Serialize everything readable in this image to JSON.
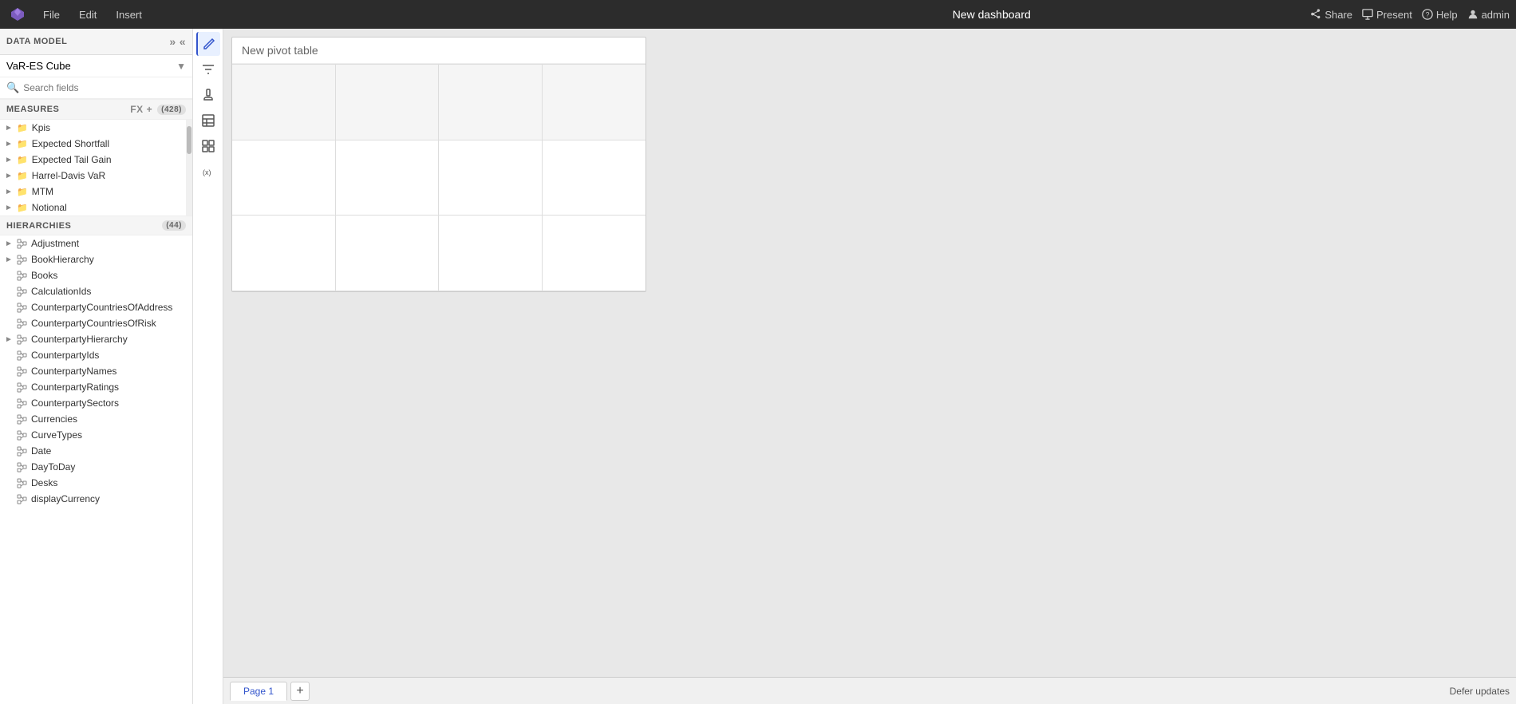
{
  "app": {
    "title": "New dashboard"
  },
  "menubar": {
    "file": "File",
    "edit": "Edit",
    "insert": "Insert",
    "share": "Share",
    "present": "Present",
    "help": "Help",
    "user": "admin"
  },
  "sidebar": {
    "data_model_label": "DATA MODEL",
    "data_model_selected": "VaR-ES Cube",
    "search_placeholder": "Search fields",
    "measures_label": "MEASURES",
    "measures_count": "(428)",
    "hierarchies_label": "HIERARCHIES",
    "hierarchies_count": "(44)",
    "measures": [
      {
        "label": "Kpis",
        "type": "folder"
      },
      {
        "label": "Expected Shortfall",
        "type": "folder"
      },
      {
        "label": "Expected Tail Gain",
        "type": "folder"
      },
      {
        "label": "Harrel-Davis VaR",
        "type": "folder"
      },
      {
        "label": "MTM",
        "type": "folder"
      },
      {
        "label": "Notional",
        "type": "folder"
      }
    ],
    "hierarchies": [
      {
        "label": "Adjustment"
      },
      {
        "label": "BookHierarchy"
      },
      {
        "label": "Books"
      },
      {
        "label": "CalculationIds"
      },
      {
        "label": "CounterpartyCountriesOfAddress"
      },
      {
        "label": "CounterpartyCountriesOfRisk"
      },
      {
        "label": "CounterpartyHierarchy"
      },
      {
        "label": "CounterpartyIds"
      },
      {
        "label": "CounterpartyNames"
      },
      {
        "label": "CounterpartyRatings"
      },
      {
        "label": "CounterpartySectors"
      },
      {
        "label": "Currencies"
      },
      {
        "label": "CurveTypes"
      },
      {
        "label": "Date"
      },
      {
        "label": "DayToDay"
      },
      {
        "label": "Desks"
      },
      {
        "label": "displayCurrency"
      }
    ]
  },
  "toolbar": {
    "buttons": [
      {
        "name": "pencil",
        "icon": "✏",
        "active": true
      },
      {
        "name": "filter",
        "icon": "⊞"
      },
      {
        "name": "paint",
        "icon": "🖌"
      },
      {
        "name": "table",
        "icon": "⊟"
      },
      {
        "name": "pivot",
        "icon": "⊞"
      },
      {
        "name": "variable",
        "icon": "(x)"
      }
    ]
  },
  "pivot": {
    "title": "New pivot table"
  },
  "pages": {
    "tabs": [
      {
        "label": "Page 1",
        "active": true
      }
    ],
    "add_label": "+",
    "defer_updates": "Defer updates"
  }
}
